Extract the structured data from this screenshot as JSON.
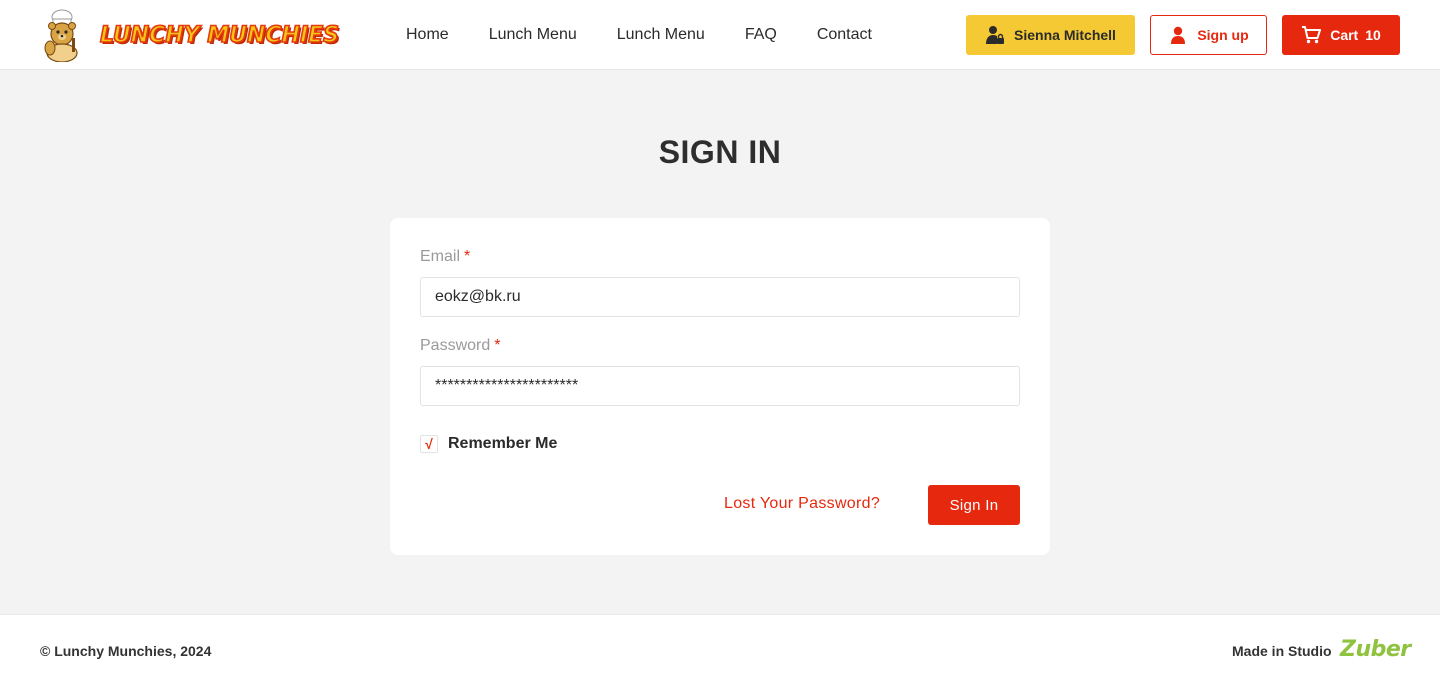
{
  "header": {
    "logo_text": "LUNCHY MUNCHIES",
    "nav": [
      "Home",
      "Lunch Menu",
      "Lunch Menu",
      "FAQ",
      "Contact"
    ],
    "user_button": "Sienna Mitchell",
    "signup_button": "Sign up",
    "cart_label": "Cart",
    "cart_count": "10"
  },
  "main": {
    "title": "SIGN IN",
    "email_label": "Email",
    "email_value": "eokz@bk.ru",
    "password_label": "Password",
    "password_value": "***********************",
    "required_mark": "*",
    "remember_label": "Remember Me",
    "remember_check": "√",
    "lost_password": "Lost Your Password?",
    "signin_button": "Sign In"
  },
  "footer": {
    "copyright": "© Lunchy Munchies, 2024",
    "made_in": "Made in Studio",
    "studio_logo": "Zuber"
  },
  "colors": {
    "accent": "#e6280f",
    "user_button": "#f5c933",
    "studio_logo": "#8fc23f",
    "page_background": "#f3f3f3"
  },
  "icons": {
    "user_button": "user-lock-icon",
    "signup_button": "user-icon",
    "cart_button": "cart-icon",
    "logo": "chef-bear-mascot-icon"
  }
}
